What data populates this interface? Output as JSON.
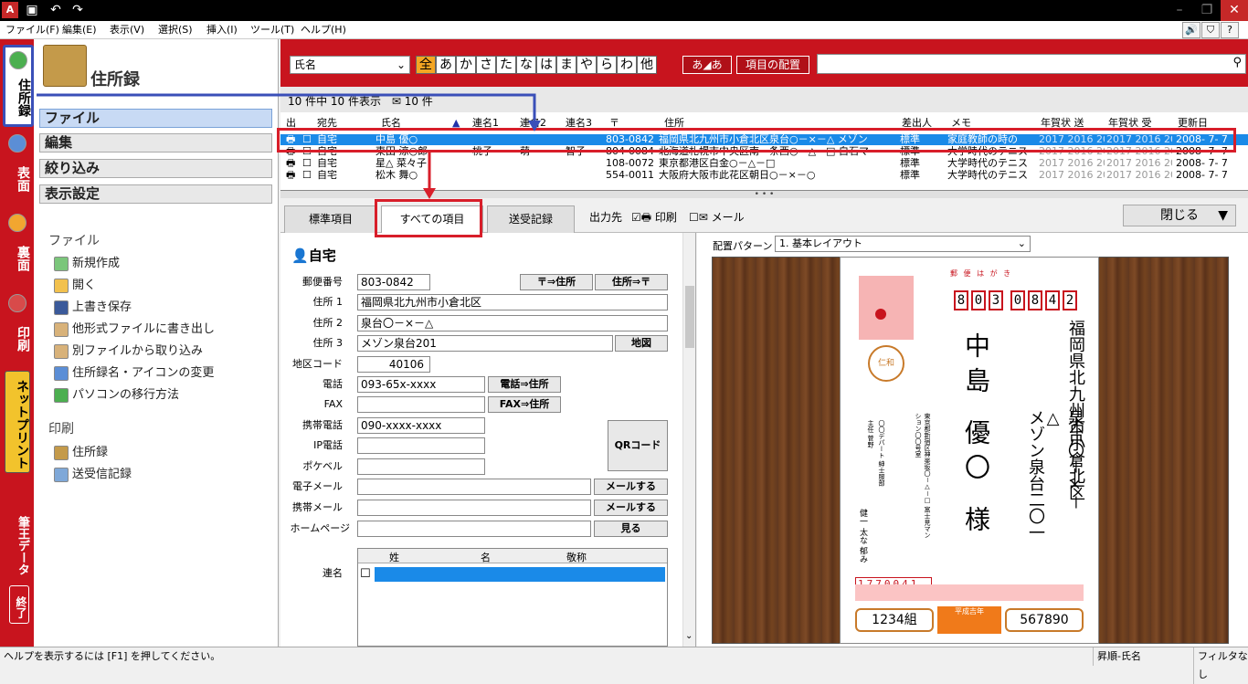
{
  "titlebar": {
    "app_icon": "A",
    "save_icon": "save-icon",
    "undo_icon": "undo-icon",
    "redo_icon": "redo-icon"
  },
  "menu": [
    "ファイル(F)",
    "編集(E)",
    "表示(V)",
    "選択(S)",
    "挿入(I)",
    "ツール(T)",
    "ヘルプ(H)"
  ],
  "menu_right": [
    "🔊",
    "⛉",
    "?"
  ],
  "lefttabs": {
    "addressbook": "住所録",
    "front": "表面",
    "back": "裏面",
    "print": "印刷",
    "netprint": "ネットプリント",
    "fude": "筆王データ",
    "exit": "終了"
  },
  "nav": {
    "title": "住所録",
    "buttons": [
      "ファイル",
      "編集",
      "絞り込み",
      "表示設定"
    ],
    "file_header": "ファイル",
    "file_items": [
      "新規作成",
      "開く",
      "上書き保存",
      "他形式ファイルに書き出し",
      "別ファイルから取り込み",
      "住所録名・アイコンの変更",
      "パソコンの移行方法"
    ],
    "print_header": "印刷",
    "print_items": [
      "住所録",
      "送受信記録"
    ]
  },
  "topbar": {
    "field_select": "氏名",
    "kana": [
      "全",
      "あ",
      "か",
      "さ",
      "た",
      "な",
      "は",
      "ま",
      "や",
      "ら",
      "わ",
      "他"
    ],
    "kana_toggle": "あ◢あ",
    "layout_btn": "項目の配置",
    "search_placeholder": ""
  },
  "count_text": "10 件中 10 件表示",
  "count_extra": "10 件",
  "grid": {
    "headers": [
      "出",
      "宛先",
      "氏名",
      "連名1",
      "連名2",
      "連名3",
      "〒",
      "住所",
      "差出人",
      "メモ",
      "年賀状 送",
      "年賀状 受",
      "更新日"
    ],
    "rows": [
      {
        "dest": "自宅",
        "name": "中島 優○",
        "r1": "",
        "r2": "",
        "r3": "",
        "zip": "803-0842",
        "addr": "福岡県北九州市小倉北区泉台○－×－△ メゾン",
        "sender": "標準",
        "memo": "家庭教師の時の",
        "send": "2017 2016 20",
        "recv": "2017 2016 20",
        "date": "2008- 7- 7",
        "selected": true
      },
      {
        "dest": "自宅",
        "name": "東田 涼○郎",
        "r1": "桃子",
        "r2": "萌",
        "r3": "智子",
        "zip": "804-0084",
        "addr": "北海道札幌市中央区南一条西○－△－□ 白石マ",
        "sender": "標準",
        "memo": "大学時代のテニス",
        "send": "2017 2016 20",
        "recv": "2017 2016 20",
        "date": "2008- 7- 7",
        "selected": false
      },
      {
        "dest": "自宅",
        "name": "星△ 菜々子",
        "r1": "",
        "r2": "",
        "r3": "",
        "zip": "108-0072",
        "addr": "東京都港区白金○－△－□",
        "sender": "標準",
        "memo": "大学時代のテニス",
        "send": "2017 2016 20",
        "recv": "2017 2016 20",
        "date": "2008- 7- 7",
        "selected": false
      },
      {
        "dest": "自宅",
        "name": "松木 舞○",
        "r1": "",
        "r2": "",
        "r3": "",
        "zip": "554-0011",
        "addr": "大阪府大阪市此花区朝日○－×－○",
        "sender": "標準",
        "memo": "大学時代のテニス",
        "send": "2017 2016 20",
        "recv": "2017 2016 20",
        "date": "2008- 7- 7",
        "selected": false
      }
    ]
  },
  "tabs": {
    "standard": "標準項目",
    "all": "すべての項目",
    "records": "送受記録",
    "output": "出力先",
    "print": "印刷",
    "mail": "メール",
    "close": "閉じる"
  },
  "detail": {
    "section": "自宅",
    "labels": {
      "zip": "郵便番号",
      "addr1": "住所 1",
      "addr2": "住所 2",
      "addr3": "住所 3",
      "area": "地区コード",
      "tel": "電話",
      "fax": "FAX",
      "mobile": "携帯電話",
      "ip": "IP電話",
      "pager": "ポケベル",
      "email": "電子メール",
      "mobile_mail": "携帯メール",
      "homepage": "ホームページ",
      "renmei": "連名"
    },
    "values": {
      "zip": "803-0842",
      "addr1": "福岡県北九州市小倉北区",
      "addr2": "泉台〇－×－△",
      "addr3": "メゾン泉台201",
      "area": "40106",
      "tel": "093-65x-xxxx",
      "fax": "",
      "mobile": "090-xxxx-xxxx",
      "ip": "",
      "pager": "",
      "email": "",
      "mobile_mail": "",
      "homepage": ""
    },
    "buttons": {
      "zip_to_addr": "〒⇒住所",
      "addr_to_zip": "住所⇒〒",
      "map": "地図",
      "tel_to_addr": "電話⇒住所",
      "fax_to_addr": "FAX⇒住所",
      "qr": "QRコード",
      "send_mail": "メールする",
      "send_mobile": "メールする",
      "view": "見る"
    },
    "renmei_headers": [
      "姓",
      "名",
      "敬称"
    ]
  },
  "preview": {
    "layout_label": "配置パターン",
    "layout_value": "1. 基本レイアウト",
    "card_header": "郵 便 は が き",
    "zip_digits": [
      "8",
      "0",
      "3",
      "0",
      "8",
      "4",
      "2"
    ],
    "recipient_addr1": "福岡県北九州市小倉北区",
    "recipient_addr2": "泉台〇－×－△",
    "recipient_addr3": "メゾン泉台二〇一",
    "recipient_name": "中島 優〇 様",
    "sender_addr": "東京都新宿区神楽坂〇－△－□ 富士見マンション〇〇号室",
    "sender_company": "〇〇デパート 紳士服部",
    "sender_title": "主任 菅野",
    "sender_name": "健一 太な 郁み",
    "sender_zip": "1770041",
    "lottery_left": "1234組",
    "lottery_stamp": "平成吉年",
    "lottery_right": "567890",
    "postmark": "仁和"
  },
  "status": {
    "left": "ヘルプを表示するには [F1] を押してください。",
    "sort": "昇順-氏名",
    "filter": "フィルタなし"
  },
  "colors": {
    "red": "#c8141e",
    "select": "#1a8ae8",
    "tab_blue": "#3a4fb8",
    "annot": "#d81e2a"
  }
}
